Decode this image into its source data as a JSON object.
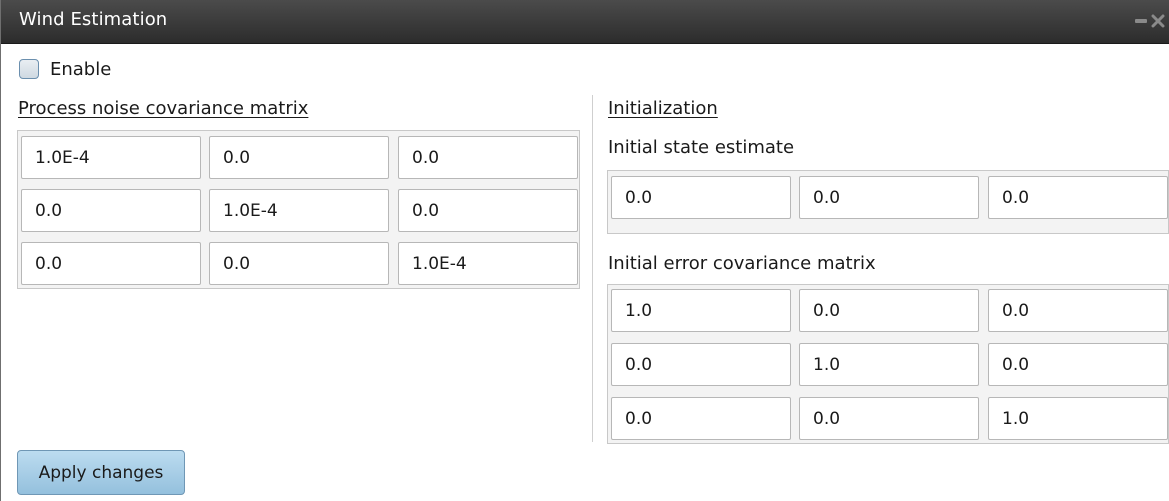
{
  "window": {
    "title": "Wind Estimation"
  },
  "enable": {
    "label": "Enable",
    "checked": false
  },
  "process_noise": {
    "label": "Process noise covariance matrix",
    "matrix": [
      [
        "1.0E-4",
        "0.0",
        "0.0"
      ],
      [
        "0.0",
        "1.0E-4",
        "0.0"
      ],
      [
        "0.0",
        "0.0",
        "1.0E-4"
      ]
    ]
  },
  "initialization": {
    "label": "Initialization",
    "state_label": "Initial state estimate",
    "state": [
      "0.0",
      "0.0",
      "0.0"
    ],
    "error_label": "Initial error covariance matrix",
    "error_matrix": [
      [
        "1.0",
        "0.0",
        "0.0"
      ],
      [
        "0.0",
        "1.0",
        "0.0"
      ],
      [
        "0.0",
        "0.0",
        "1.0"
      ]
    ]
  },
  "apply_label": "Apply changes",
  "icons": {
    "minimize": "minimize-icon",
    "close": "close-icon"
  },
  "colors": {
    "titlebar": "#3a3a3a",
    "button": "#a8cfe8",
    "checkbox_border": "#6b8fae"
  }
}
